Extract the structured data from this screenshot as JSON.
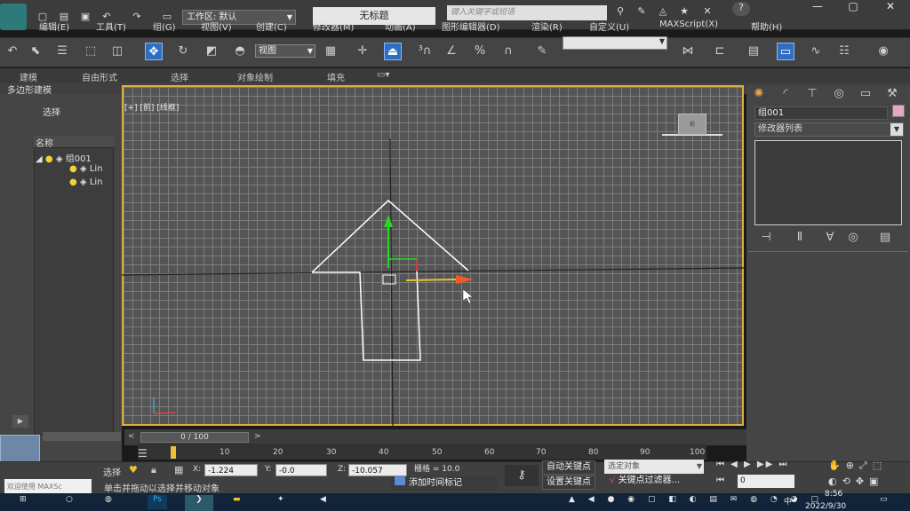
{
  "titlebar": {
    "workspace_label": "工作区: 默认",
    "doc_title": "无标题",
    "search_placeholder": "键入关键字或短语"
  },
  "menu": [
    "编辑(E)",
    "工具(T)",
    "组(G)",
    "视图(V)",
    "创建(C)",
    "修改器(M)",
    "动画(A)",
    "图形编辑器(D)",
    "渲染(R)",
    "自定义(U)",
    "MAXScript(X)",
    "帮助(H)"
  ],
  "toolbar": {
    "view_combo": "视图"
  },
  "ribbon": {
    "tabs": [
      "建模",
      "自由形式",
      "选择",
      "对象绘制",
      "填充"
    ],
    "sub_label": "多边形建模"
  },
  "scene_explorer": {
    "select_label": "选择",
    "name_header": "名称",
    "group": "组001",
    "children": [
      "Lin",
      "Lin"
    ]
  },
  "viewport": {
    "label": "[+] [前] [线框]",
    "viewcube_label": "前"
  },
  "command_panel": {
    "object_name": "组001",
    "modifier_list": "修改器列表",
    "object_color": "#e3a9c2"
  },
  "timeline": {
    "thumb_label": "0 / 100",
    "ticks": [
      "10",
      "20",
      "30",
      "40",
      "50",
      "60",
      "70",
      "80",
      "90",
      "100"
    ]
  },
  "status": {
    "selected_label": "选择",
    "x_label": "X:",
    "x_value": "-1.224",
    "y_label": "Y:",
    "y_value": "-0.0",
    "z_label": "Z:",
    "z_value": "-10.057",
    "grid_label": "栅格 = 10.0",
    "prompt": "单击并拖动以选择并移动对象",
    "add_time_tag": "添加时间标记",
    "auto_key": "自动关键点",
    "set_key": "设置关键点",
    "selected_object_combo": "选定对象",
    "key_filters": "关键点过滤器...",
    "frame_value": "0",
    "maxscript_hint": "欢迎使用 MAXSc"
  },
  "taskbar": {
    "time": "8:56",
    "date": "2022/9/30",
    "ime": "中"
  },
  "colors": {
    "viewport_border": "#d8b23a",
    "active_tool": "#2f6fc2"
  }
}
